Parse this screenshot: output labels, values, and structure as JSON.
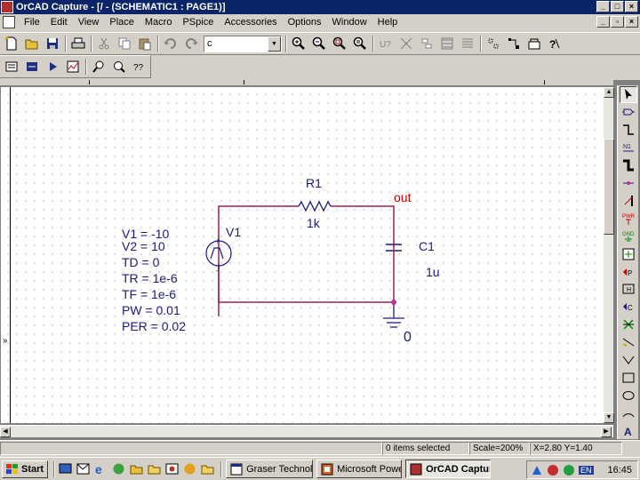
{
  "window": {
    "title": "OrCAD Capture - [/ - (SCHEMATIC1 : PAGE1)]",
    "accent": "#0a246a"
  },
  "menu": {
    "items": [
      "File",
      "Edit",
      "View",
      "Place",
      "Macro",
      "PSpice",
      "Accessories",
      "Options",
      "Window",
      "Help"
    ]
  },
  "toolbar": {
    "part_combo_value": "c",
    "icons": [
      "new-icon",
      "open-icon",
      "save-icon",
      "print-icon",
      "cut-icon",
      "copy-icon",
      "paste-icon",
      "undo-icon",
      "redo-icon",
      "zoom-in-icon",
      "zoom-out-icon",
      "zoom-area-icon",
      "zoom-all-icon",
      "annotate-icon",
      "back-annotate-icon",
      "drc-icon",
      "netlist-icon",
      "crossref-icon",
      "bom-icon",
      "snap-grid-icon",
      "project-manager-icon",
      "help-icon"
    ]
  },
  "schematic": {
    "source": {
      "ref": "V1",
      "params": [
        "V1 = -10",
        "V2 = 10",
        "TD = 0",
        "TR = 1e-6",
        "TF = 1e-6",
        "PW = 0.01",
        "PER = 0.02"
      ]
    },
    "resistor": {
      "ref": "R1",
      "value": "1k"
    },
    "capacitor": {
      "ref": "C1",
      "value": "1u"
    },
    "net_label": "out",
    "ground_label": "0",
    "wire_color": "#a0204a",
    "text_color": "#1a1a80",
    "net_label_color": "#c00000"
  },
  "palette": {
    "tools": [
      "select-tool",
      "place-part-tool",
      "place-wire-tool",
      "place-net-alias-tool",
      "place-bus-tool",
      "place-junction-tool",
      "place-bus-entry-tool",
      "place-power-tool",
      "place-ground-tool",
      "place-off-page-connector-tool",
      "place-hierarchical-block-tool",
      "place-hierarchical-port-tool",
      "place-hierarchical-pin-tool",
      "place-no-connect-tool",
      "place-line-tool",
      "place-polyline-tool",
      "place-rectangle-tool",
      "place-ellipse-tool",
      "place-arc-tool",
      "place-text-tool"
    ]
  },
  "status": {
    "selection": "0 items selected",
    "scale": "Scale=200%",
    "coords": "X=2.80  Y=1.40"
  },
  "taskbar": {
    "start_label": "Start",
    "tasks": [
      "Graser Technol...",
      "Microsoft Powe...",
      "OrCAD Captur..."
    ],
    "language": "EN",
    "clock": "16:45"
  }
}
